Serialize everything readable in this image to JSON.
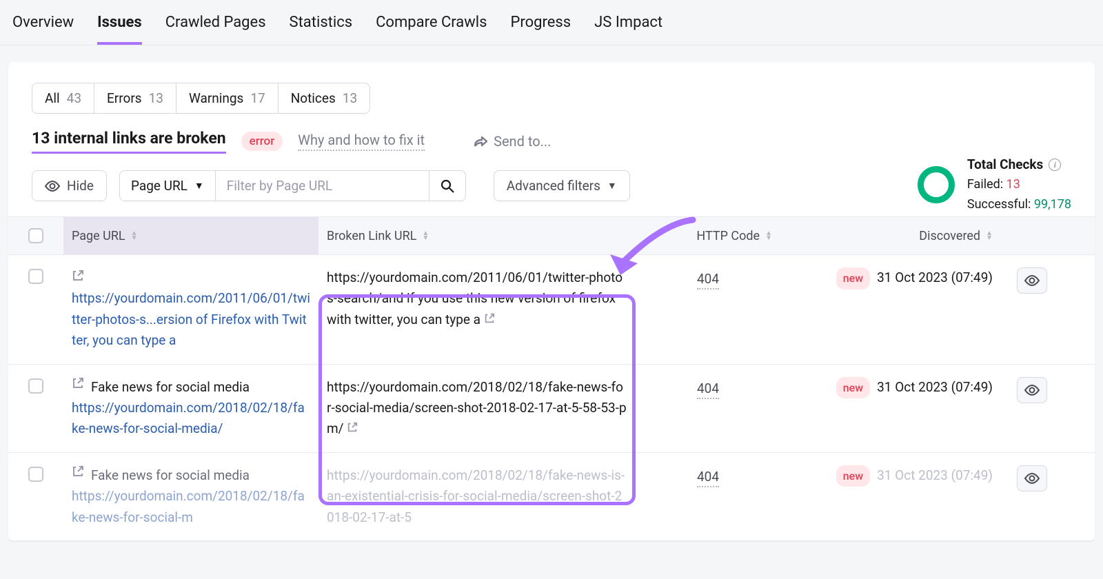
{
  "tabs": [
    "Overview",
    "Issues",
    "Crawled Pages",
    "Statistics",
    "Compare Crawls",
    "Progress",
    "JS Impact"
  ],
  "activeTab": "Issues",
  "pills": [
    {
      "label": "All",
      "count": "43"
    },
    {
      "label": "Errors",
      "count": "13"
    },
    {
      "label": "Warnings",
      "count": "17"
    },
    {
      "label": "Notices",
      "count": "13"
    }
  ],
  "report": {
    "title": "13 internal links are broken",
    "badge": "error",
    "whyLink": "Why and how to fix it",
    "sendTo": "Send to..."
  },
  "controls": {
    "hide": "Hide",
    "filterLabel": "Page URL",
    "filterPlaceholder": "Filter by Page URL",
    "advanced": "Advanced filters"
  },
  "stats": {
    "title": "Total Checks",
    "failedLabel": "Failed:",
    "failed": "13",
    "successLabel": "Successful:",
    "success": "99,178"
  },
  "columns": [
    "Page URL",
    "Broken Link URL",
    "HTTP Code",
    "Discovered"
  ],
  "rows": [
    {
      "pageTitle": "",
      "pageUrl": "https://yourdomain.com/2011/06/01/twitter-photos-s...ersion of Firefox with Twitter, you can type a",
      "brokenUrl": "https://yourdomain.com/2011/06/01/twitter-photos-search/and if you use this new version of firefox with twitter, you can type a",
      "httpCode": "404",
      "isNew": true,
      "newLabel": "new",
      "discovered": "31 Oct 2023 (07:49)"
    },
    {
      "pageTitle": "Fake news for social media",
      "pageUrl": "https://yourdomain.com/2018/02/18/fake-news-for-social-media/",
      "brokenUrl": "https://yourdomain.com/2018/02/18/fake-news-for-social-media/screen-shot-2018-02-17-at-5-58-53-pm/",
      "httpCode": "404",
      "isNew": true,
      "newLabel": "new",
      "discovered": "31 Oct 2023 (07:49)"
    },
    {
      "pageTitle": "Fake news for social media",
      "pageUrl": "https://yourdomain.com/2018/02/18/fake-news-for-social-m",
      "brokenUrl": "https://yourdomain.com/2018/02/18/fake-news-is-an-existential-crisis-for-social-media/screen-shot-2018-02-17-at-5",
      "httpCode": "404",
      "isNew": true,
      "newLabel": "new",
      "discovered": "31 Oct 2023 (07:49)"
    }
  ]
}
